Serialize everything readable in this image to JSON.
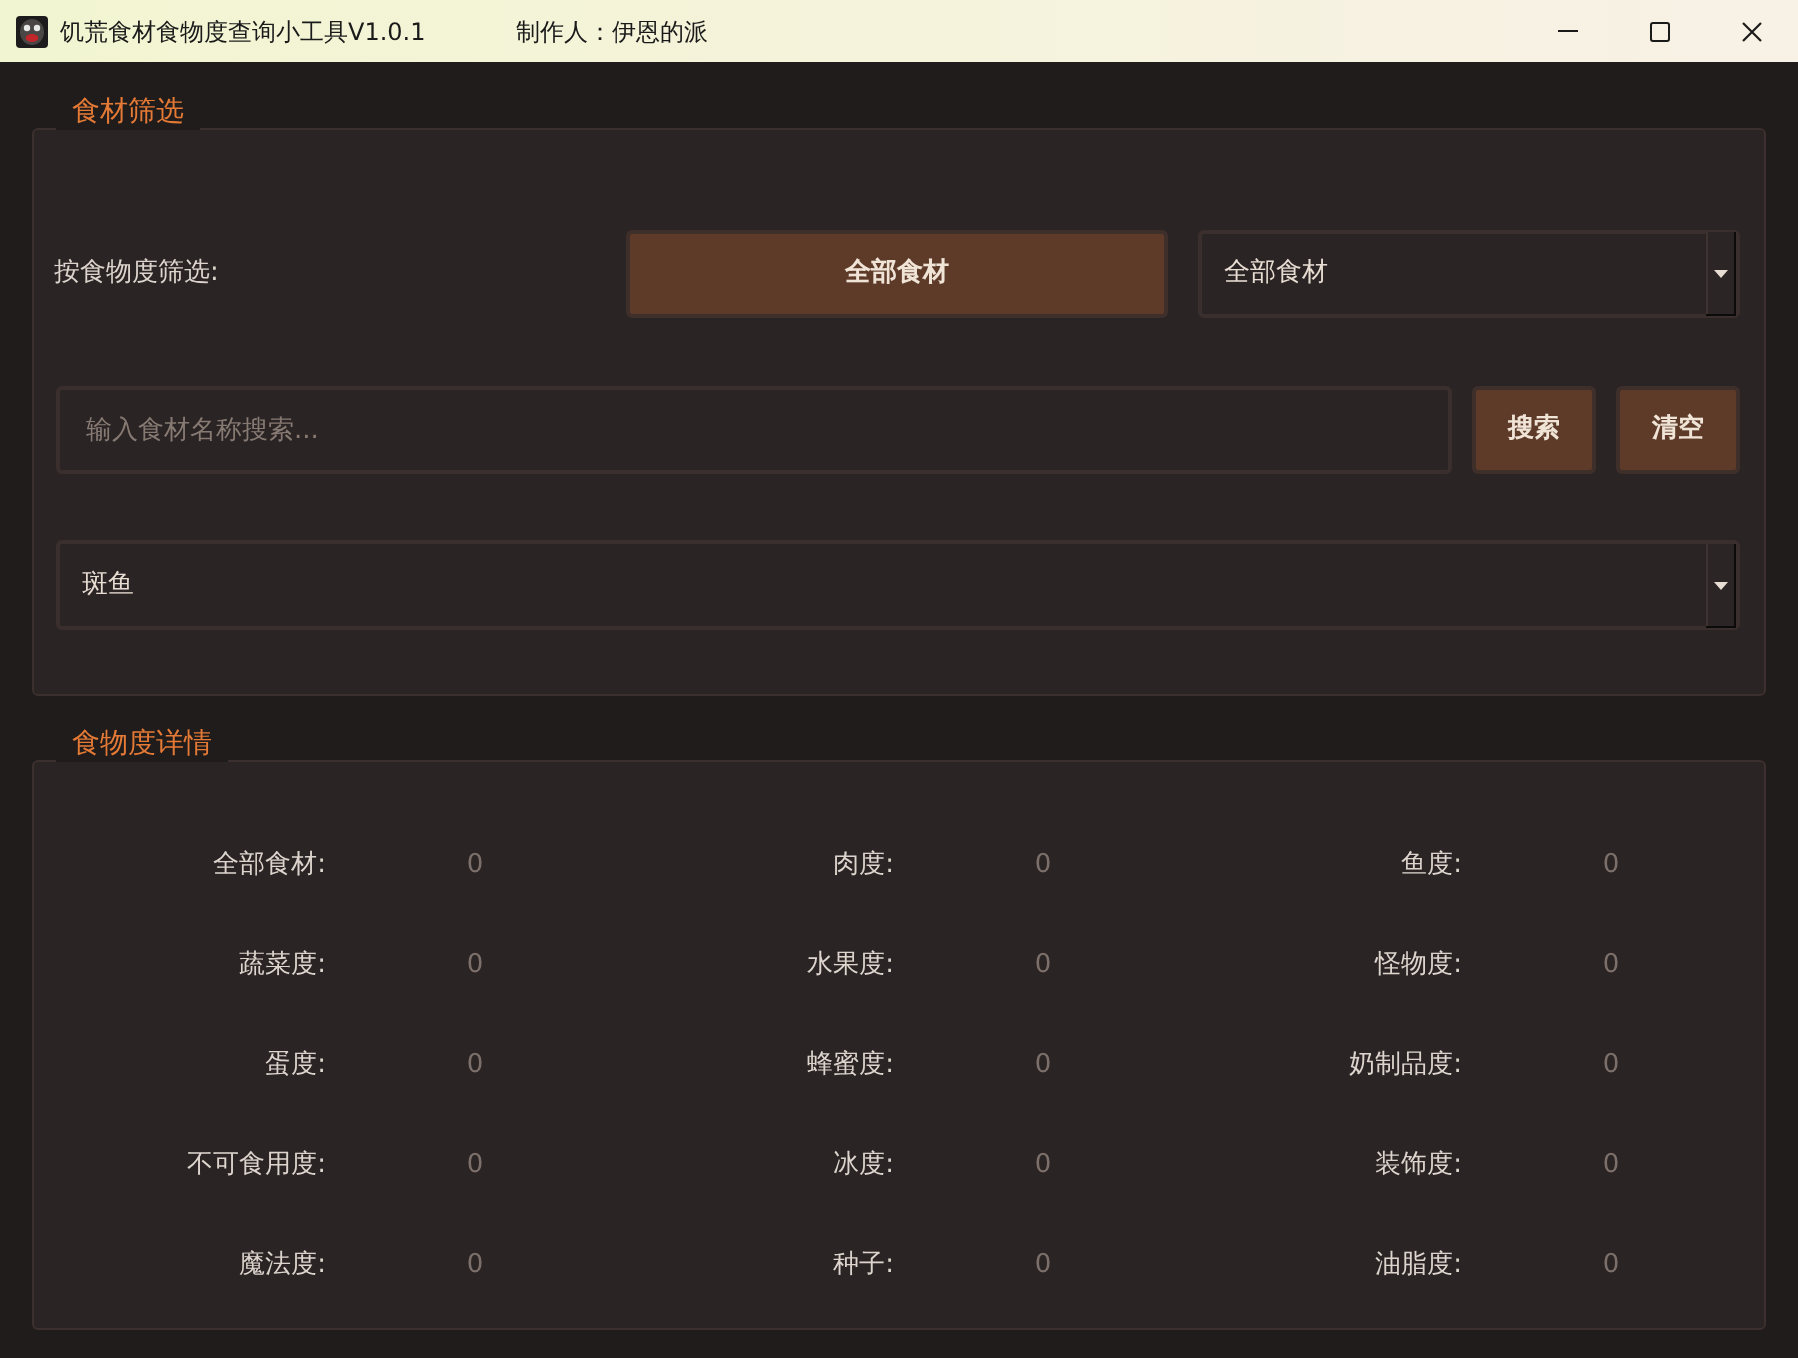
{
  "window": {
    "title": "饥荒食材食物度查询小工具V1.0.1",
    "author": "制作人：伊恩的派"
  },
  "filter_group": {
    "title": "食材筛选",
    "filter_label": "按食物度筛选:",
    "category_button": "全部食材",
    "category_select": {
      "value": "全部食材"
    },
    "search": {
      "placeholder": "输入食材名称搜索..."
    },
    "buttons": [
      "搜索",
      "清空"
    ],
    "ingredient_select": {
      "value": "斑鱼"
    }
  },
  "details_group": {
    "title": "食物度详情",
    "stats": [
      {
        "label": "全部食材:",
        "value": "0"
      },
      {
        "label": "肉度:",
        "value": "0"
      },
      {
        "label": "鱼度:",
        "value": "0"
      },
      {
        "label": "蔬菜度:",
        "value": "0"
      },
      {
        "label": "水果度:",
        "value": "0"
      },
      {
        "label": "怪物度:",
        "value": "0"
      },
      {
        "label": "蛋度:",
        "value": "0"
      },
      {
        "label": "蜂蜜度:",
        "value": "0"
      },
      {
        "label": "奶制品度:",
        "value": "0"
      },
      {
        "label": "不可食用度:",
        "value": "0"
      },
      {
        "label": "冰度:",
        "value": "0"
      },
      {
        "label": "装饰度:",
        "value": "0"
      },
      {
        "label": "魔法度:",
        "value": "0"
      },
      {
        "label": "种子:",
        "value": "0"
      },
      {
        "label": "油脂度:",
        "value": "0"
      }
    ]
  }
}
